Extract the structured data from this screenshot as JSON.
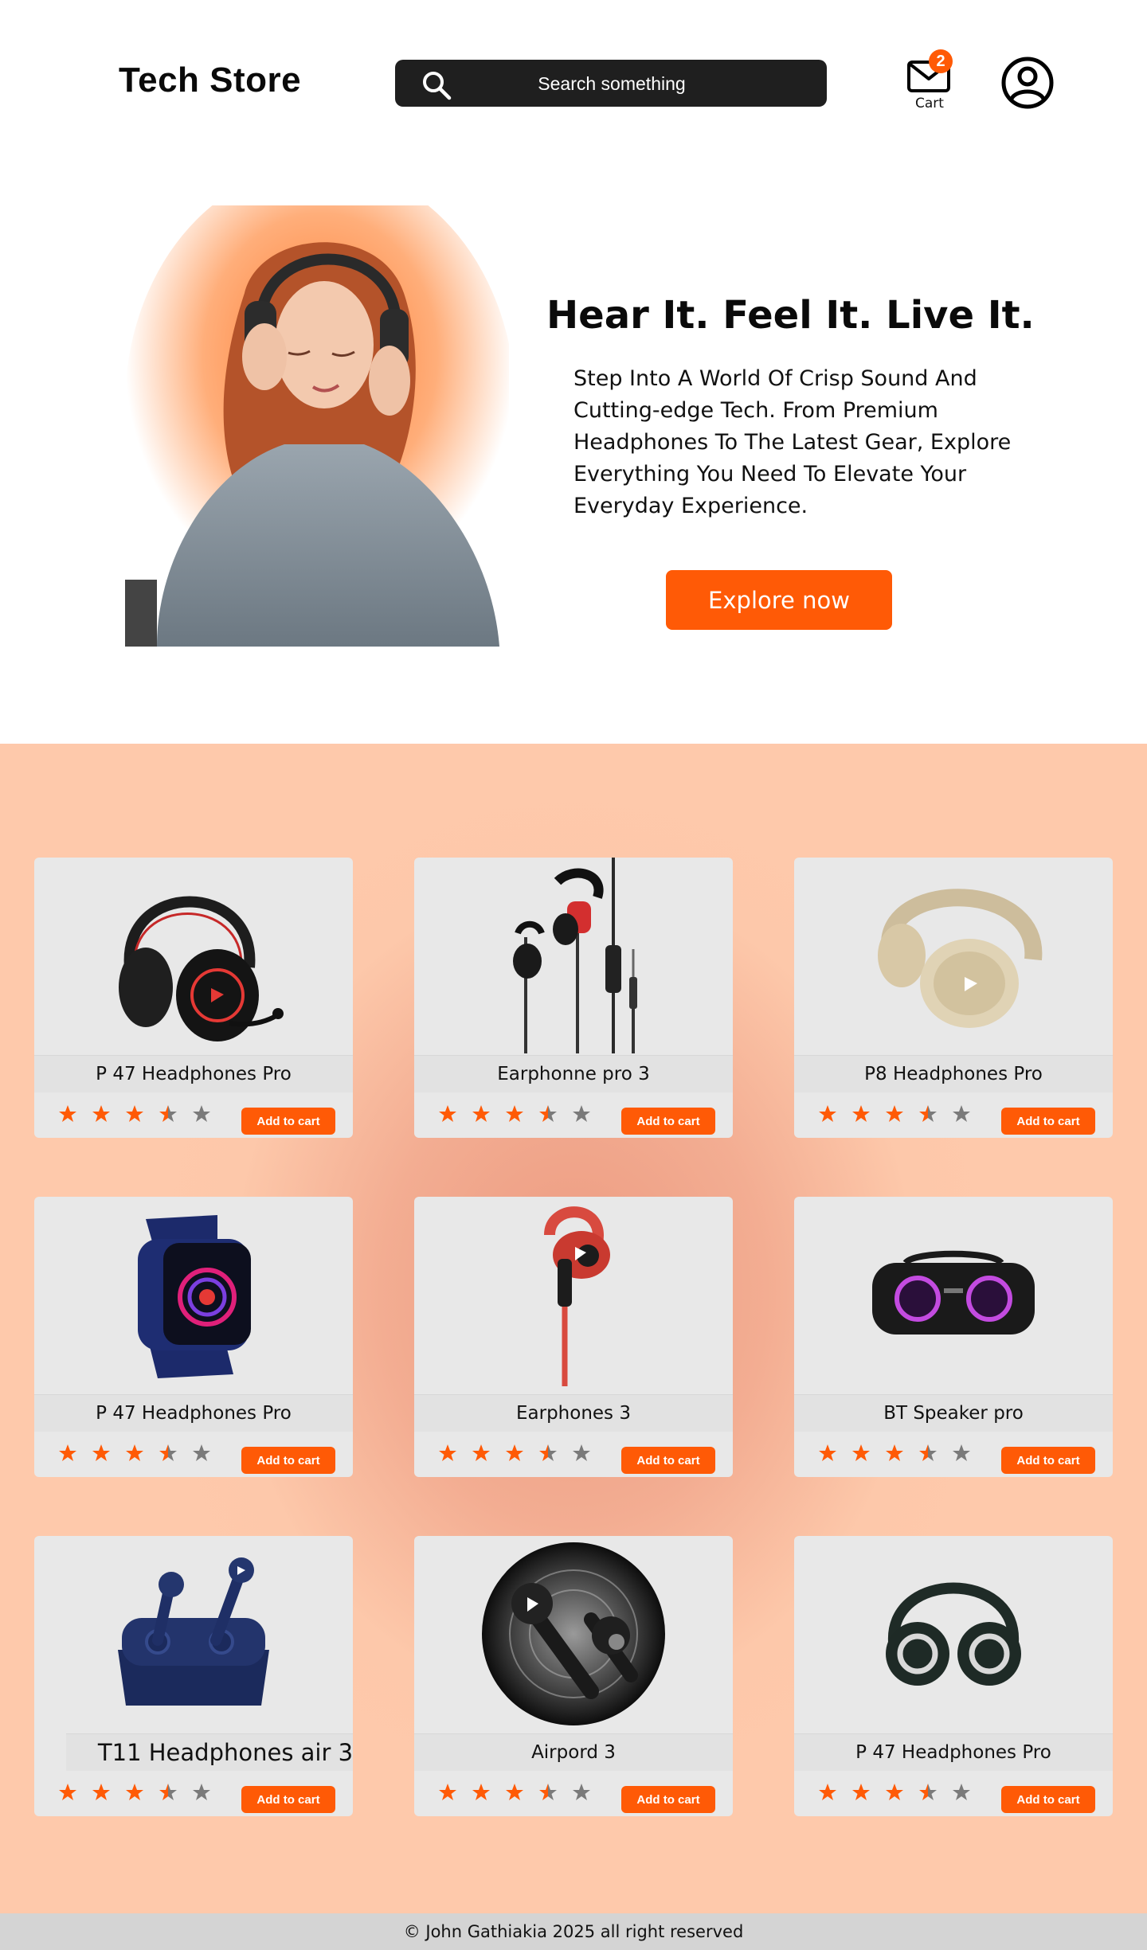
{
  "header": {
    "brand": "Tech Store",
    "search_placeholder": "Search something",
    "cart_count": "2",
    "cart_label": "Cart"
  },
  "hero": {
    "title": "Hear It. Feel It. Live It.",
    "text": "Step Into A World Of Crisp Sound And Cutting-edge Tech. From Premium Headphones To The Latest Gear, Explore Everything You Need To Elevate Your Everyday Experience.",
    "cta": "Explore now"
  },
  "products": [
    {
      "name": "P 47 Headphones Pro",
      "image": "black-red-gaming-headset",
      "rating": 3.5,
      "cta": "Add to cart"
    },
    {
      "name": "Earphonne pro 3",
      "image": "black-red-wired-earphones",
      "rating": 3.5,
      "cta": "Add to cart"
    },
    {
      "name": "P8 Headphones Pro",
      "image": "beige-headphones",
      "rating": 3.5,
      "cta": "Add to cart"
    },
    {
      "name": "P 47 Headphones Pro",
      "image": "navy-smartwatch",
      "rating": 3.5,
      "cta": "Add to cart"
    },
    {
      "name": "Earphones 3",
      "image": "red-sport-earphone",
      "rating": 3.5,
      "cta": "Add to cart"
    },
    {
      "name": "BT Speaker pro",
      "image": "black-bluetooth-speaker",
      "rating": 3.5,
      "cta": "Add to cart"
    },
    {
      "name": "T11 Headphones air 3",
      "image": "navy-wireless-earbuds-case",
      "rating": 3.5,
      "cta": "Add to cart"
    },
    {
      "name": "Airpord 3",
      "image": "black-earbuds-on-disc",
      "rating": 3.5,
      "cta": "Add to cart"
    },
    {
      "name": "P 47 Headphones Pro",
      "image": "dark-green-headphones",
      "rating": 3.5,
      "cta": "Add to cart"
    }
  ],
  "footer": {
    "text": "© John Gathiakia 2025 all right reserved"
  },
  "colors": {
    "accent": "#ff5a06",
    "search_bg": "#1f1f1f",
    "card_bg": "#e8e8e8",
    "section_bg": "#fdc8aa"
  }
}
